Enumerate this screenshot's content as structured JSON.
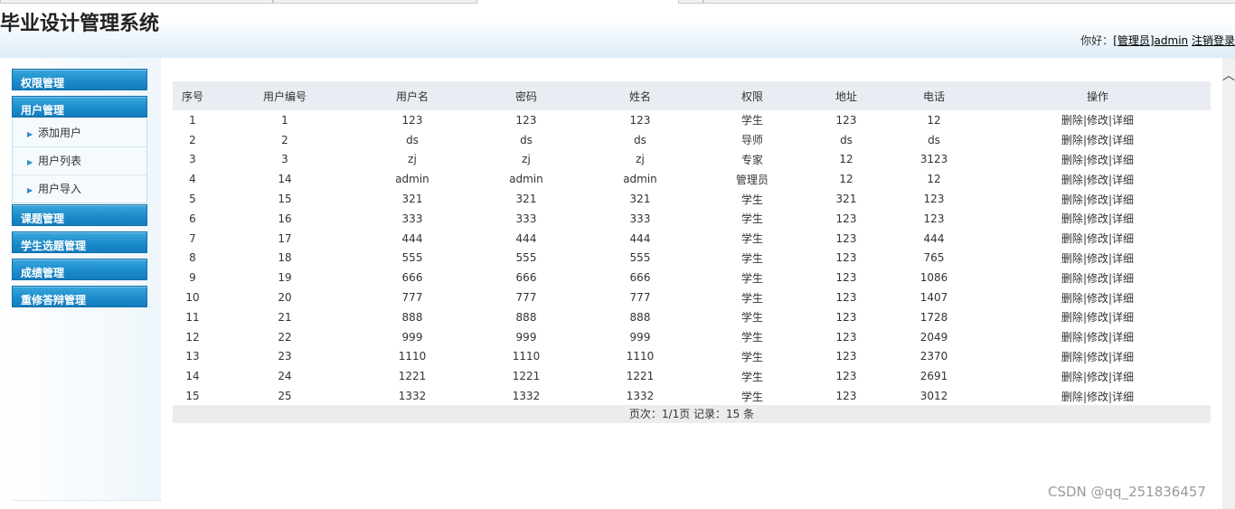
{
  "header": {
    "title": "毕业设计管理系统",
    "greeting": "你好：",
    "user_link": "[管理员]admin",
    "logout": "注销登录"
  },
  "sidebar": {
    "groups": [
      {
        "label": "权限管理"
      },
      {
        "label": "用户管理"
      },
      {
        "label": "课题管理"
      },
      {
        "label": "学生选题管理"
      },
      {
        "label": "成绩管理"
      },
      {
        "label": "重修答辩管理"
      }
    ],
    "user_submenu": [
      {
        "label": "添加用户"
      },
      {
        "label": "用户列表"
      },
      {
        "label": "用户导入"
      }
    ]
  },
  "table": {
    "headers": [
      "序号",
      "用户编号",
      "用户名",
      "密码",
      "姓名",
      "权限",
      "地址",
      "电话",
      "操作"
    ],
    "ops": {
      "delete": "删除",
      "edit": "修改",
      "detail": "详细",
      "sep": "|"
    },
    "rows": [
      [
        "1",
        "1",
        "123",
        "123",
        "123",
        "学生",
        "123",
        "12"
      ],
      [
        "2",
        "2",
        "ds",
        "ds",
        "ds",
        "导师",
        "ds",
        "ds"
      ],
      [
        "3",
        "3",
        "zj",
        "zj",
        "zj",
        "专家",
        "12",
        "3123"
      ],
      [
        "4",
        "14",
        "admin",
        "admin",
        "admin",
        "管理员",
        "12",
        "12"
      ],
      [
        "5",
        "15",
        "321",
        "321",
        "321",
        "学生",
        "321",
        "123"
      ],
      [
        "6",
        "16",
        "333",
        "333",
        "333",
        "学生",
        "123",
        "123"
      ],
      [
        "7",
        "17",
        "444",
        "444",
        "444",
        "学生",
        "123",
        "444"
      ],
      [
        "8",
        "18",
        "555",
        "555",
        "555",
        "学生",
        "123",
        "765"
      ],
      [
        "9",
        "19",
        "666",
        "666",
        "666",
        "学生",
        "123",
        "1086"
      ],
      [
        "10",
        "20",
        "777",
        "777",
        "777",
        "学生",
        "123",
        "1407"
      ],
      [
        "11",
        "21",
        "888",
        "888",
        "888",
        "学生",
        "123",
        "1728"
      ],
      [
        "12",
        "22",
        "999",
        "999",
        "999",
        "学生",
        "123",
        "2049"
      ],
      [
        "13",
        "23",
        "1110",
        "1110",
        "1110",
        "学生",
        "123",
        "2370"
      ],
      [
        "14",
        "24",
        "1221",
        "1221",
        "1221",
        "学生",
        "123",
        "2691"
      ],
      [
        "15",
        "25",
        "1332",
        "1332",
        "1332",
        "学生",
        "123",
        "3012"
      ]
    ]
  },
  "pager": {
    "text": "页次：1/1页 记录：15 条"
  },
  "scrollbar": {
    "up_icon": "chevron-up-icon"
  },
  "watermark": "CSDN @qq_251836457"
}
